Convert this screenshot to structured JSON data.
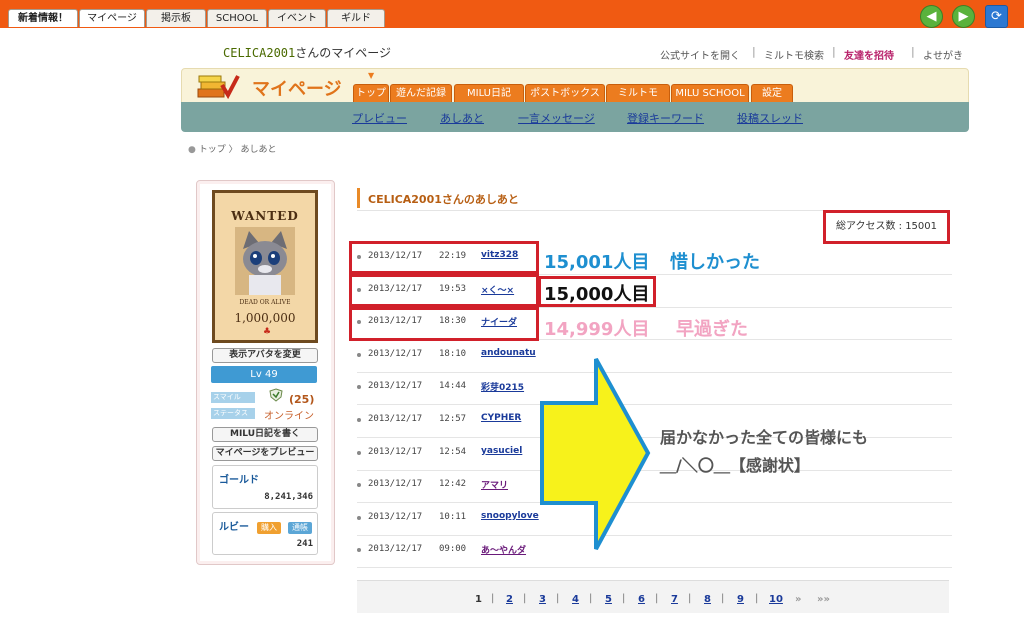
{
  "topbar": {
    "tabs": [
      "新着情報！",
      "マイページ",
      "掲示板",
      "SCHOOL",
      "イベント",
      "ギルド"
    ]
  },
  "header": {
    "username": "CELICA2001",
    "title_suffix": "さんのマイページ",
    "links": [
      "公式サイトを開く",
      "ミルトモ検索",
      "友達を招待",
      "よせがき"
    ]
  },
  "nav": {
    "title": "マイページ",
    "tabs": [
      "トップ",
      "遊んだ記録",
      "MILU日記",
      "ポストボックス",
      "ミルトモ",
      "MILU SCHOOL",
      "設定"
    ],
    "subnav": [
      "プレビュー",
      "あしあと",
      "一言メッセージ",
      "登録キーワード",
      "投稿スレッド"
    ]
  },
  "breadcrumb": {
    "home": "トップ",
    "current": "あしあと"
  },
  "profile": {
    "wanted_title": "WANTED",
    "wanted_sub": "DEAD OR ALIVE",
    "bounty": "1,000,000",
    "change_avatar": "表示アバタを変更",
    "level": "Lv 49",
    "smile_label": "スマイル",
    "status_label": "ステータス",
    "smile_count": "(25)",
    "status": "オンライン",
    "write_diary": "MILU日記を書く",
    "preview": "マイページをプレビュー",
    "gold_label": "ゴールド",
    "gold": "8,241,346",
    "ruby_label": "ルビー",
    "ruby_buy": "購入",
    "ruby_history": "通帳",
    "ruby": "241"
  },
  "footprints": {
    "title": "CELICA2001さんのあしあと",
    "total_label": "総アクセス数 : 15001",
    "rows": [
      {
        "date": "2013/12/17",
        "time": "22:19",
        "name": "vitz328",
        "color": "#1a3a9a"
      },
      {
        "date": "2013/12/17",
        "time": "19:53",
        "name": "×く～×",
        "color": "#1a3a9a"
      },
      {
        "date": "2013/12/17",
        "time": "18:30",
        "name": "ナイーダ",
        "color": "#1a3a9a"
      },
      {
        "date": "2013/12/17",
        "time": "18:10",
        "name": "andounatu",
        "color": "#1a3a9a"
      },
      {
        "date": "2013/12/17",
        "time": "14:44",
        "name": "彩芽0215",
        "color": "#1a3a9a"
      },
      {
        "date": "2013/12/17",
        "time": "12:57",
        "name": "CYPHER",
        "color": "#1a3a9a"
      },
      {
        "date": "2013/12/17",
        "time": "12:54",
        "name": "yasuciel",
        "color": "#1a3a9a"
      },
      {
        "date": "2013/12/17",
        "time": "12:42",
        "name": "アマリ",
        "color": "#6a1a7a"
      },
      {
        "date": "2013/12/17",
        "time": "10:11",
        "name": "snoopylove",
        "color": "#1a3a9a"
      },
      {
        "date": "2013/12/17",
        "time": "09:00",
        "name": "あ～やんダ",
        "color": "#6a1a7a"
      }
    ]
  },
  "annotations": {
    "a1_count": "15,001人目",
    "a1_note": "惜しかった",
    "a2": "15,000人目",
    "a3_count": "14,999人目",
    "a3_note": "早過ぎた",
    "thanks_line1": "届かなかった全ての皆様にも",
    "thanks_line2": "＿/＼〇＿【感謝状】"
  },
  "pagination": {
    "pages": [
      "1",
      "2",
      "3",
      "4",
      "5",
      "6",
      "7",
      "8",
      "9",
      "10"
    ],
    "current": "1",
    "next": "»",
    "last": "»»"
  },
  "colors": {
    "topbar": "#f05a12",
    "accent_orange": "#ec7c1f",
    "subnav_bar": "#7ba4a0",
    "red_highlight": "#d1202a",
    "annotation_blue": "#1e8fd0",
    "annotation_pink": "#f2a4c2",
    "arrow_yellow": "#f7f21b",
    "arrow_border": "#1e8fd0"
  }
}
